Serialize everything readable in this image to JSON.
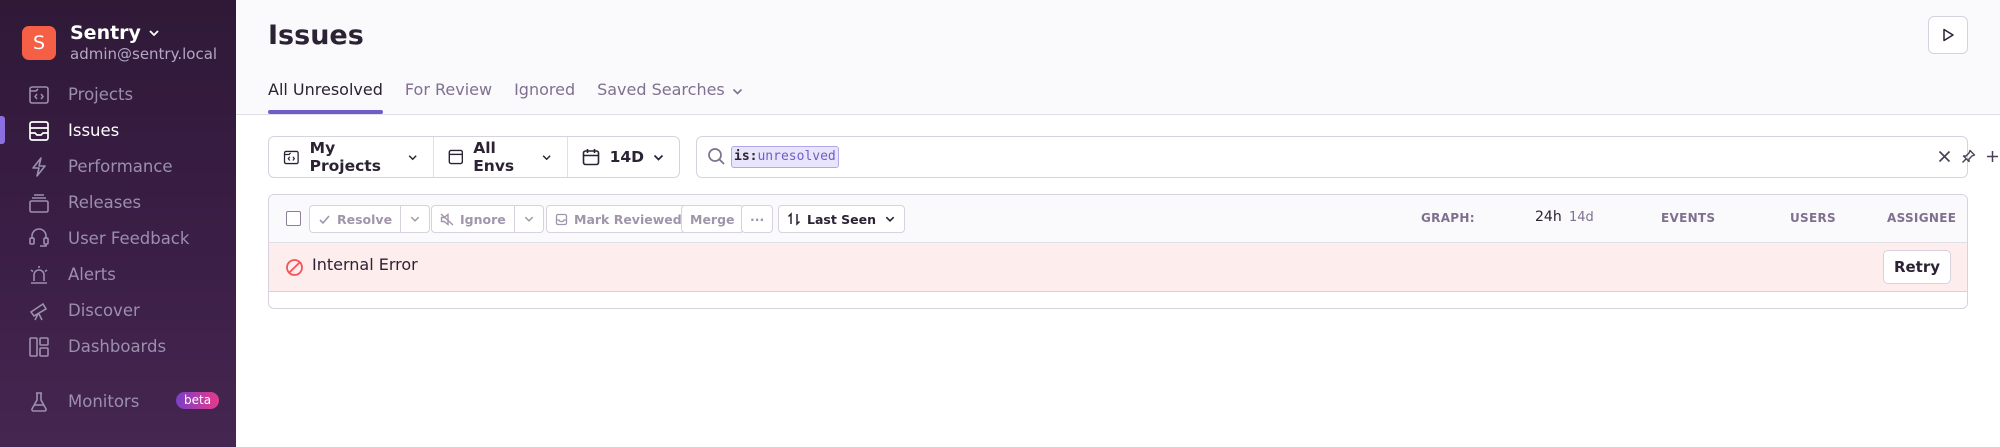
{
  "sidebar": {
    "org_initial": "S",
    "org_name": "Sentry",
    "org_email": "admin@sentry.local",
    "items": [
      {
        "label": "Projects",
        "icon": "projects-icon"
      },
      {
        "label": "Issues",
        "icon": "issues-icon",
        "active": true
      },
      {
        "label": "Performance",
        "icon": "performance-icon"
      },
      {
        "label": "Releases",
        "icon": "releases-icon"
      },
      {
        "label": "User Feedback",
        "icon": "user-feedback-icon"
      },
      {
        "label": "Alerts",
        "icon": "alerts-icon"
      },
      {
        "label": "Discover",
        "icon": "discover-icon"
      },
      {
        "label": "Dashboards",
        "icon": "dashboards-icon"
      }
    ],
    "monitors": {
      "label": "Monitors",
      "badge": "beta",
      "icon": "monitors-icon"
    }
  },
  "header": {
    "title": "Issues",
    "tabs": [
      {
        "label": "All Unresolved",
        "active": true
      },
      {
        "label": "For Review"
      },
      {
        "label": "Ignored"
      },
      {
        "label": "Saved Searches"
      }
    ]
  },
  "filters": {
    "project": "My Projects",
    "environment": "All Envs",
    "period": "14D"
  },
  "search": {
    "key": "is",
    "separator": ":",
    "value": "unresolved"
  },
  "toolbar": {
    "resolve": "Resolve",
    "ignore": "Ignore",
    "mark_reviewed": "Mark Reviewed",
    "merge": "Merge",
    "more": "···",
    "sort": "Last Seen"
  },
  "columns": {
    "graph": "GRAPH:",
    "period_24h": "24h",
    "period_14d": "14d",
    "events": "EVENTS",
    "users": "USERS",
    "assignee": "ASSIGNEE"
  },
  "error": {
    "message": "Internal Error",
    "retry": "Retry"
  },
  "colors": {
    "sidebar": "#2f1937",
    "accent": "#6c5fc7",
    "org_avatar": "#f55f45",
    "error_bg": "#fdeded",
    "error_icon": "#f55459"
  }
}
